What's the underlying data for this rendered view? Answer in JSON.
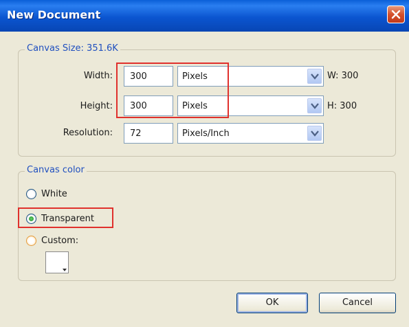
{
  "dialog": {
    "title": "New Document"
  },
  "canvas_size": {
    "legend": "Canvas Size: 351.6K",
    "width": {
      "label": "Width:",
      "value": "300",
      "unit": "Pixels",
      "readout": "W: 300"
    },
    "height": {
      "label": "Height:",
      "value": "300",
      "unit": "Pixels",
      "readout": "H: 300"
    },
    "resolution": {
      "label": "Resolution:",
      "value": "72",
      "unit": "Pixels/Inch"
    }
  },
  "canvas_color": {
    "legend": "Canvas color",
    "options": [
      {
        "label": "White",
        "selected": false
      },
      {
        "label": "Transparent",
        "selected": true
      },
      {
        "label": "Custom:",
        "selected": false
      }
    ],
    "custom_swatch_color": "#ffffff"
  },
  "buttons": {
    "ok": "OK",
    "cancel": "Cancel"
  },
  "colors": {
    "title_bar": "#0b55d0",
    "highlight": "#e0302c",
    "group_label": "#1f4fbf",
    "selected_dot": "#1e8a28"
  }
}
